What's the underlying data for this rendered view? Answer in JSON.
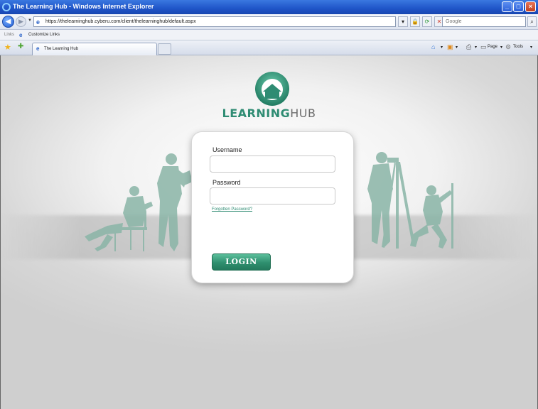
{
  "window": {
    "title": "The Learning Hub - Windows Internet Explorer"
  },
  "address_bar": {
    "url": "https://thelearninghub.cyberu.com/client/thelearninghub/default.aspx",
    "search_placeholder": "Google"
  },
  "links_bar": {
    "label": "Links",
    "items": [
      "Customize Links"
    ]
  },
  "tabs": [
    {
      "label": "The Learning Hub"
    }
  ],
  "command_bar": {
    "page_label": "Page",
    "tools_label": "Tools"
  },
  "logo": {
    "word1": "LEARNING",
    "word2": "HUB"
  },
  "login": {
    "username_label": "Username",
    "username_value": "",
    "password_label": "Password",
    "password_value": "",
    "forgot_link": "Forgotten Password?",
    "button_label": "LOGIN"
  },
  "colors": {
    "brand_teal": "#2f8c73",
    "button_gradient_top": "#5bbf9b",
    "button_gradient_bottom": "#237a5c",
    "titlebar_blue": "#1f55c8",
    "silhouette": "#8ab5a7"
  }
}
